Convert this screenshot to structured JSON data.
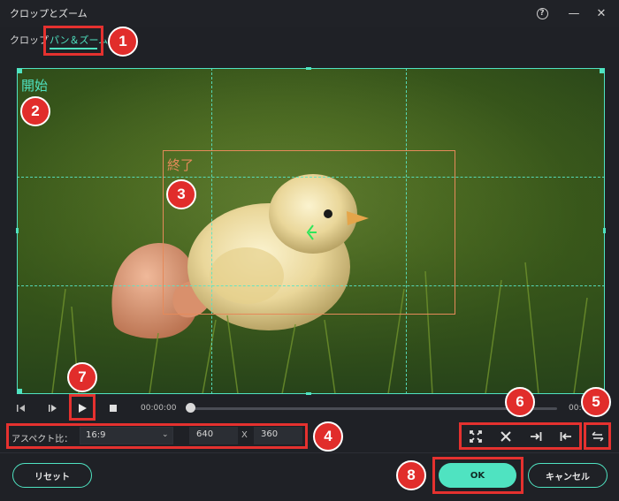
{
  "window": {
    "title": "クロップとズーム"
  },
  "tabs": [
    {
      "label": "クロップ"
    },
    {
      "label": "パン＆ズーム"
    }
  ],
  "preview": {
    "start_label": "開始",
    "end_label": "終了"
  },
  "playback": {
    "current_time": "00:00:00",
    "end_time": "00:0"
  },
  "aspect": {
    "label": "アスペクト比：",
    "value": "16:9",
    "width": "640",
    "separator": "X",
    "height": "360"
  },
  "buttons": {
    "reset": "リセット",
    "ok": "OK",
    "cancel": "キャンセル"
  },
  "annotations": [
    "1",
    "2",
    "3",
    "4",
    "5",
    "6",
    "7",
    "8"
  ],
  "colors": {
    "accent": "#4fe3c1",
    "callout": "#e12d2b",
    "end_box": "#e58a5a",
    "background": "#1f2126"
  }
}
